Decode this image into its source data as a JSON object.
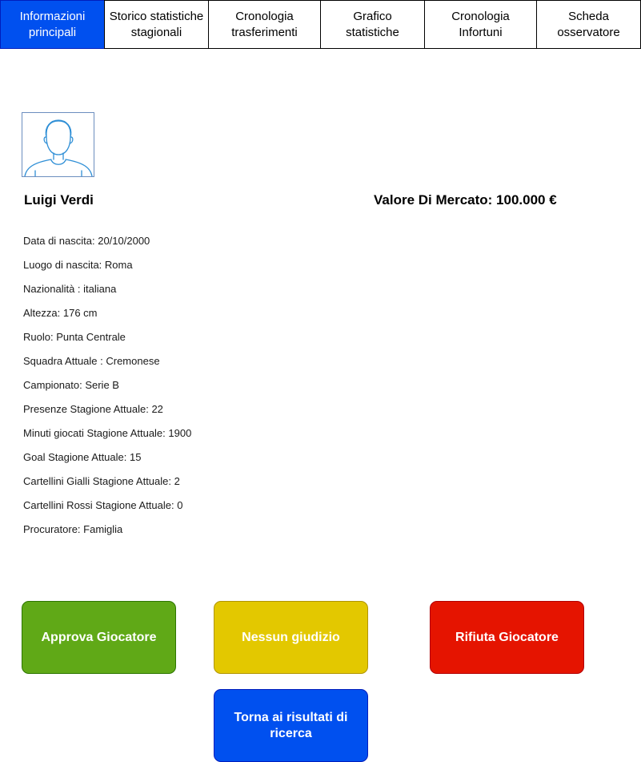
{
  "tabs": [
    {
      "label": "Informazioni\nprincipali",
      "active": true
    },
    {
      "label": "Storico statistiche\nstagionali",
      "active": false
    },
    {
      "label": "Cronologia\ntrasferimenti",
      "active": false
    },
    {
      "label": "Grafico\nstatistiche",
      "active": false
    },
    {
      "label": "Cronologia\nInfortuni",
      "active": false
    },
    {
      "label": "Scheda\nosservatore",
      "active": false
    }
  ],
  "player": {
    "avatar_icon": "user-avatar-icon",
    "name": "Luigi Verdi",
    "market_value": "Valore Di Mercato: 100.000 €",
    "details": [
      "Data di nascita: 20/10/2000",
      "Luogo di nascita: Roma",
      "Nazionalità : italiana",
      "Altezza: 176 cm",
      "Ruolo: Punta Centrale",
      "Squadra Attuale : Cremonese",
      "Campionato: Serie B",
      "Presenze Stagione Attuale: 22",
      "Minuti giocati Stagione Attuale: 1900",
      "Goal Stagione Attuale: 15",
      "Cartellini Gialli Stagione Attuale: 2",
      "Cartellini Rossi Stagione Attuale: 0",
      "Procuratore: Famiglia"
    ]
  },
  "actions": {
    "approve_label": "Approva Giocatore",
    "neutral_label": "Nessun giudizio",
    "reject_label": "Rifiuta Giocatore",
    "back_label": "Torna ai risultati di ricerca"
  },
  "colors": {
    "tab_active": "#0050ef",
    "approve": "#60a917",
    "neutral": "#e3c800",
    "reject": "#e51400",
    "back": "#0050ef"
  }
}
